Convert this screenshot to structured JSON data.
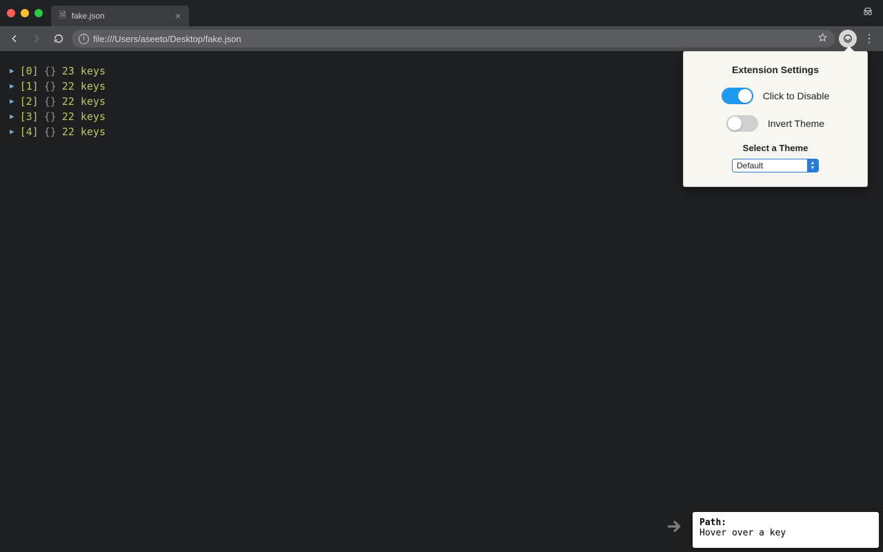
{
  "tab": {
    "title": "fake.json"
  },
  "url": "file:///Users/aseeto/Desktop/fake.json",
  "json_rows": [
    {
      "index": "[0]",
      "brace": "{}",
      "summary": "23 keys"
    },
    {
      "index": "[1]",
      "brace": "{}",
      "summary": "22 keys"
    },
    {
      "index": "[2]",
      "brace": "{}",
      "summary": "22 keys"
    },
    {
      "index": "[3]",
      "brace": "{}",
      "summary": "22 keys"
    },
    {
      "index": "[4]",
      "brace": "{}",
      "summary": "22 keys"
    }
  ],
  "popup": {
    "title": "Extension Settings",
    "toggle_enable_label": "Click to Disable",
    "toggle_invert_label": "Invert Theme",
    "select_label": "Select a Theme",
    "selected_theme": "Default"
  },
  "path_helper": {
    "label": "Path:",
    "hint": "Hover over a key"
  }
}
